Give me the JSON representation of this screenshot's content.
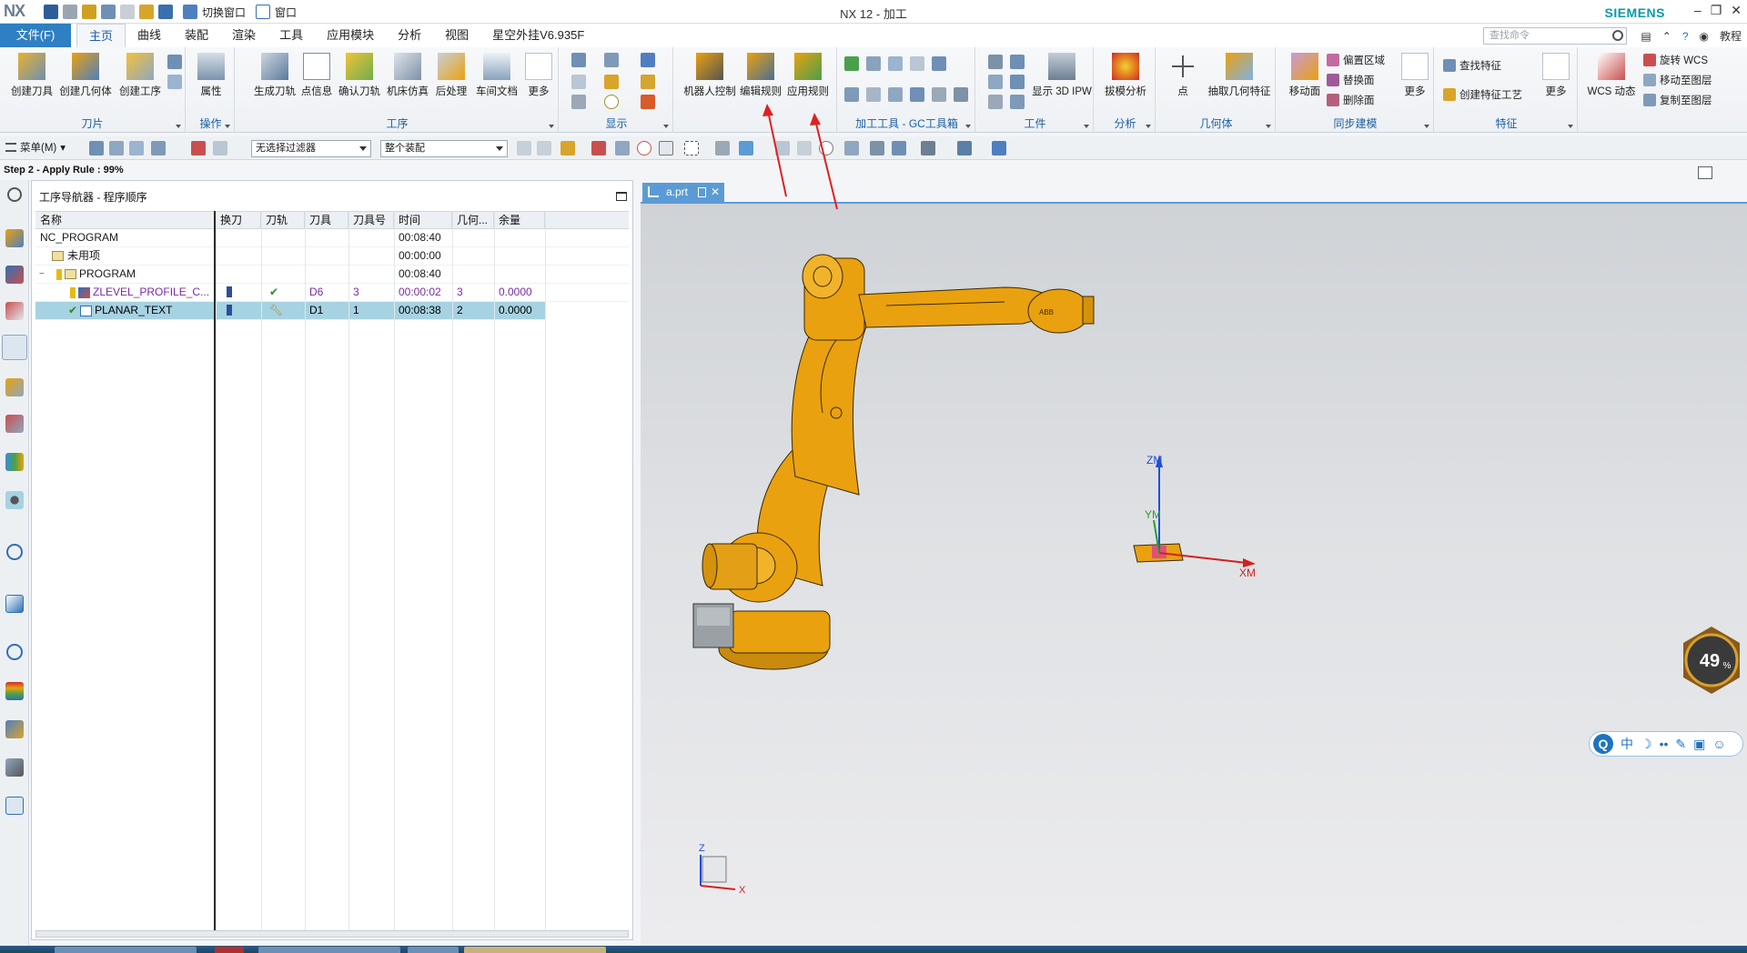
{
  "app": {
    "logo": "NX",
    "window_title": "NX 12 - 加工",
    "brand": "SIEMENS",
    "quick_access": {
      "switch_window": "切换窗口",
      "window": "窗口"
    },
    "window_controls": [
      "–",
      "❐",
      "✕"
    ]
  },
  "ribbon_tabs": {
    "file": "文件(F)",
    "tabs": [
      "主页",
      "曲线",
      "装配",
      "渲染",
      "工具",
      "应用模块",
      "分析",
      "视图",
      "星空外挂V6.935F"
    ],
    "active": "主页",
    "command_search_placeholder": "查找命令",
    "tutorial": "教程"
  },
  "ribbon": {
    "groups": {
      "insert": {
        "title": "刀片",
        "buttons": [
          "创建刀具",
          "创建几何体",
          "创建工序"
        ]
      },
      "ops": {
        "title": "操作",
        "buttons": [
          "属性"
        ]
      },
      "process": {
        "title": "工序",
        "buttons": [
          "生成刀轨",
          "点信息",
          "确认刀轨",
          "机床仿真",
          "后处理",
          "车间文档",
          "更多"
        ]
      },
      "display": {
        "title": "显示"
      },
      "robot": {
        "buttons": [
          "机器人控制",
          "编辑规则",
          "应用规则"
        ]
      },
      "gc": {
        "title": "加工工具 - GC工具箱"
      },
      "workpiece": {
        "title": "工件",
        "buttons": [
          "显示 3D IPW"
        ]
      },
      "analysis": {
        "title": "分析",
        "buttons": [
          "拔模分析"
        ]
      },
      "geometry": {
        "title": "几何体",
        "buttons": [
          "点",
          "抽取几何特征"
        ]
      },
      "sync": {
        "title": "同步建模",
        "buttons": [
          "移动面",
          "更多"
        ],
        "small": [
          "偏置区域",
          "替换面",
          "删除面"
        ]
      },
      "feature": {
        "title": "特征",
        "buttons": [
          "更多"
        ],
        "small": [
          "查找特征",
          "创建特征工艺"
        ]
      },
      "wcs": {
        "buttons": [
          "WCS 动态"
        ],
        "small": [
          "旋转 WCS",
          "移动至图层",
          "复制至图层"
        ]
      }
    }
  },
  "selection_bar": {
    "menu": "菜单(M)",
    "type_filter": "无选择过滤器",
    "scope": "整个装配"
  },
  "status": {
    "message": "Step 2 - Apply Rule : 99%"
  },
  "navigator": {
    "title": "工序导航器 - 程序顺序",
    "columns": [
      "名称",
      "换刀",
      "刀轨",
      "刀具",
      "刀具号",
      "时间",
      "几何...",
      "余量"
    ],
    "rows": [
      {
        "name": "NC_PROGRAM",
        "tool": "",
        "tool_no": "",
        "time": "00:08:40",
        "geom": "",
        "stock": "",
        "level": 0
      },
      {
        "name": "未用项",
        "tool": "",
        "tool_no": "",
        "time": "00:00:00",
        "geom": "",
        "stock": "",
        "level": 1
      },
      {
        "name": "PROGRAM",
        "tool": "",
        "tool_no": "",
        "time": "00:08:40",
        "geom": "",
        "stock": "",
        "level": 1
      },
      {
        "name": "ZLEVEL_PROFILE_C...",
        "tool": "D6",
        "tool_no": "3",
        "time": "00:00:02",
        "geom": "3",
        "stock": "0.0000",
        "level": 2
      },
      {
        "name": "PLANAR_TEXT",
        "tool": "D1",
        "tool_no": "1",
        "time": "00:08:38",
        "geom": "2",
        "stock": "0.0000",
        "level": 2
      }
    ]
  },
  "viewport": {
    "tab_label": "a.prt",
    "wcs_labels": {
      "z": "ZM",
      "y": "YM",
      "x": "XM"
    },
    "abs_labels": {
      "z": "Z",
      "x": "X"
    },
    "robot_brand": "ABB",
    "progress_badge": "49",
    "progress_unit": "%",
    "ime": [
      "中",
      "☽",
      "••",
      "✎",
      "▣",
      "☺"
    ]
  },
  "colors": {
    "accent": "#2f7fc3",
    "viewport_tab": "#5b9bd5",
    "selected_row": "#a6d2e2",
    "robot_orange": "#e9a10f",
    "annotation_arrow": "#e02020"
  }
}
